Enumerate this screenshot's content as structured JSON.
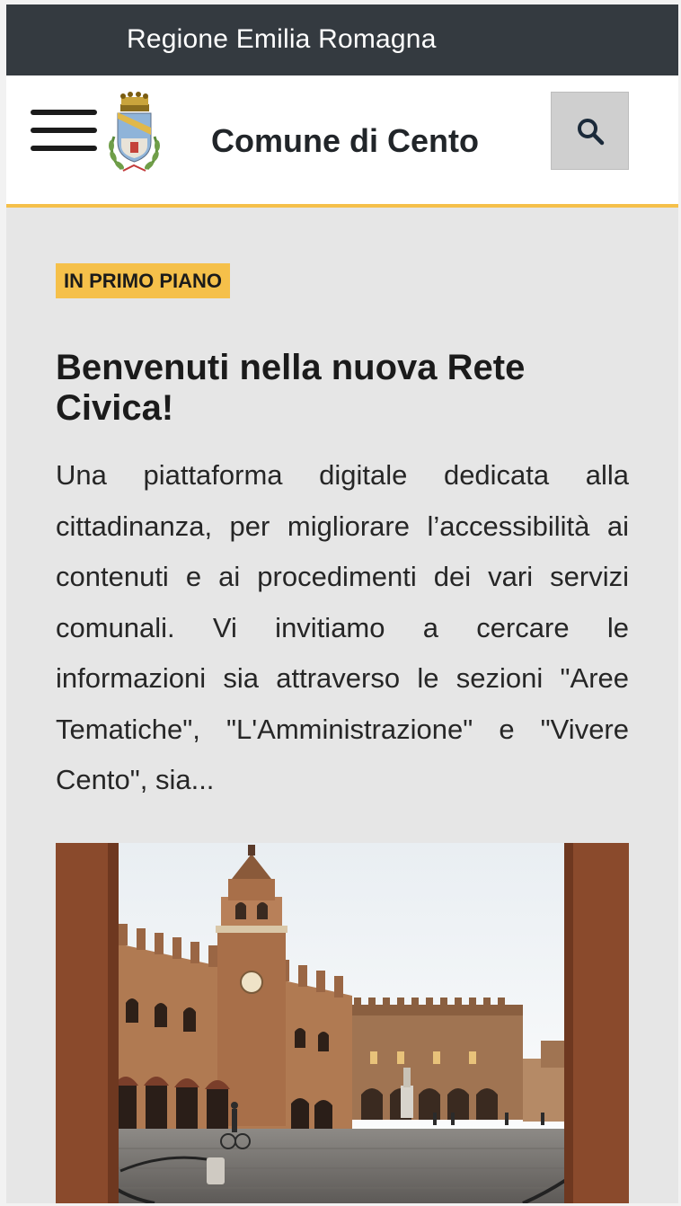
{
  "topbar": {
    "region": "Regione Emilia Romagna"
  },
  "header": {
    "site_title": "Comune di Cento"
  },
  "icons": {
    "menu": "hamburger-menu-icon",
    "search": "search-icon",
    "crest": "municipal-crest"
  },
  "colors": {
    "topbar_bg": "#343a40",
    "accent": "#f5c04a",
    "page_bg": "#e6e6e6",
    "text": "#1b1b1b"
  },
  "featured": {
    "badge": "IN PRIMO PIANO",
    "title": "Benvenuti nella nuova Rete Civica!",
    "excerpt": "Una piattaforma digitale dedicata alla cittadinanza, per migliorare l’accessibilità ai contenuti e ai procedimenti dei vari servizi comunali. Vi invitiamo a cercare le informazioni sia attraverso le sezioni \"Aree Tematiche\", \"L'Amministrazione\" e \"Vivere Cento\", sia..."
  }
}
